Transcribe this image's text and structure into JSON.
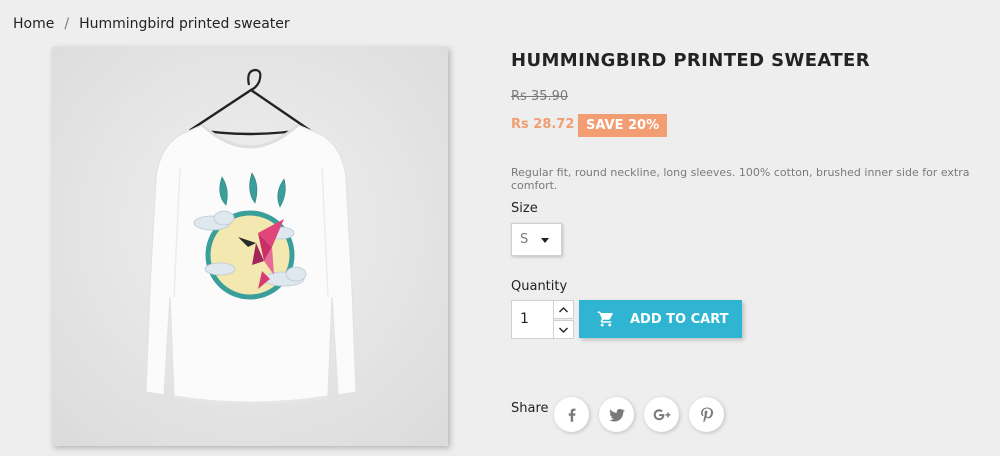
{
  "breadcrumb": {
    "home": "Home",
    "separator": "/",
    "current": "Hummingbird printed sweater"
  },
  "product": {
    "title": "HUMMINGBIRD PRINTED SWEATER",
    "regular_price": "Rs 35.90",
    "price": "Rs 28.72",
    "discount": "SAVE 20%",
    "description": "Regular fit, round neckline, long sleeves. 100% cotton, brushed inner side for extra comfort."
  },
  "size": {
    "label": "Size",
    "selected": "S"
  },
  "quantity": {
    "label": "Quantity",
    "value": "1"
  },
  "cart": {
    "label": "ADD TO CART"
  },
  "share": {
    "label": "Share",
    "networks": [
      "facebook-icon",
      "twitter-icon",
      "google-plus-icon",
      "pinterest-icon"
    ]
  },
  "colors": {
    "accent": "#2fb5d2",
    "discount": "#f39d72",
    "background": "#eeeeee",
    "text": "#232323",
    "muted": "#7a7a7a"
  }
}
